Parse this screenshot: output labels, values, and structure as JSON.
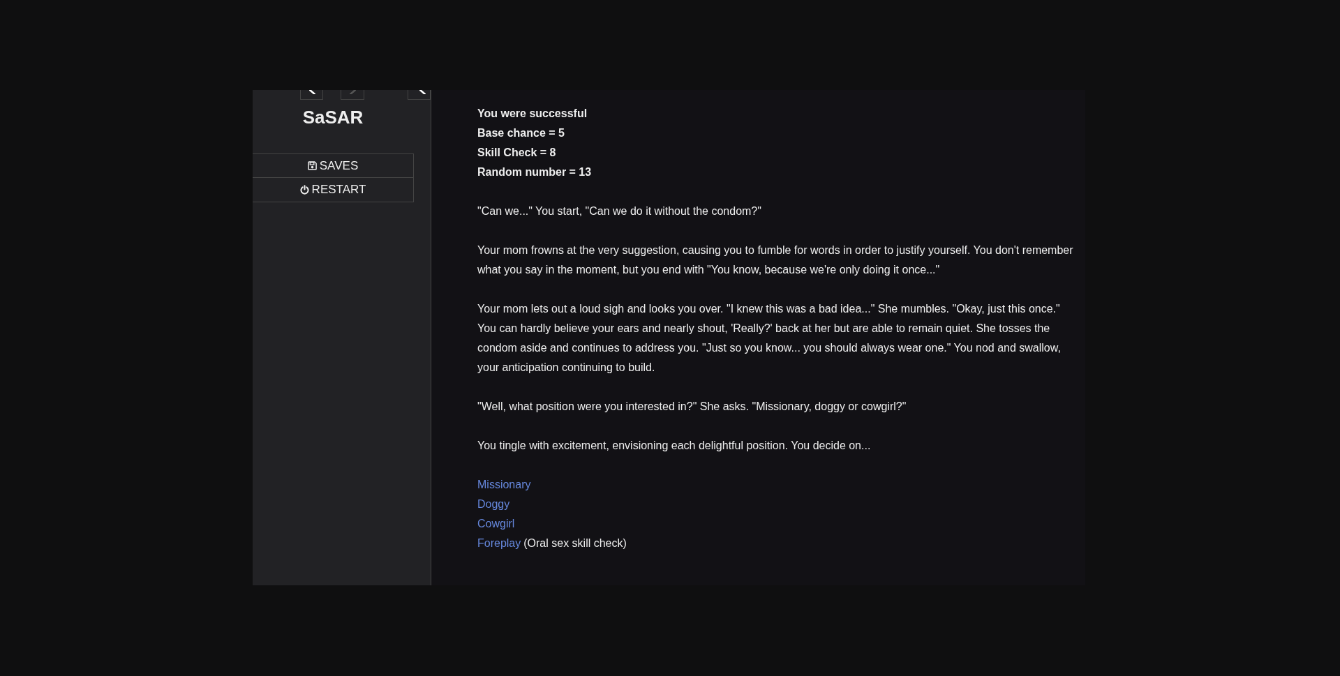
{
  "sidebar": {
    "history_buttons": [
      {
        "kind": "back",
        "disabled": false
      },
      {
        "kind": "forward",
        "disabled": true
      },
      {
        "kind": "toggle",
        "disabled": false
      }
    ],
    "title": "SaSAR",
    "menu": [
      {
        "kind": "saves",
        "label": "SAVES"
      },
      {
        "kind": "restart",
        "label": "RESTART"
      }
    ]
  },
  "passage": {
    "results": [
      "You were successful",
      "Base chance = 5",
      "Skill Check = 8",
      "Random number = 13"
    ],
    "paragraphs": [
      "\"Can we...\" You start, \"Can we do it without the condom?\"",
      "Your mom frowns at the very suggestion, causing you to fumble for words in order to justify yourself. You don't remember what you say in the moment, but you end with \"You know, because we're only doing it once...\"",
      "Your mom lets out a loud sigh and looks you over. \"I knew this was a bad idea...\" She mumbles. \"Okay, just this once.\" You can hardly believe your ears and nearly shout, 'Really?' back at her but are able to remain quiet. She tosses the condom aside and continues to address you. \"Just so you know... you should always wear one.\" You nod and swallow, your anticipation continuing to build.",
      "\"Well, what position were you interested in?\" She asks. \"Missionary, doggy or cowgirl?\"",
      "You tingle with excitement, envisioning each delightful position. You decide on..."
    ],
    "choices": [
      {
        "link": "Missionary"
      },
      {
        "link": "Doggy"
      },
      {
        "link": "Cowgirl"
      },
      {
        "link": "Foreplay",
        "note": "(Oral sex skill check)"
      }
    ]
  }
}
